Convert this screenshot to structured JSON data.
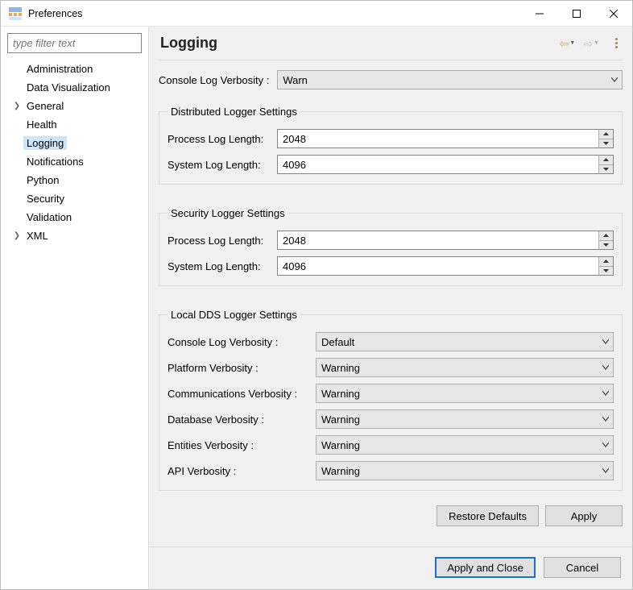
{
  "titlebar": {
    "title": "Preferences"
  },
  "filter": {
    "placeholder": "type filter text"
  },
  "tree": {
    "items": [
      {
        "label": "Administration",
        "expandable": false
      },
      {
        "label": "Data Visualization",
        "expandable": false
      },
      {
        "label": "General",
        "expandable": true
      },
      {
        "label": "Health",
        "expandable": false
      },
      {
        "label": "Logging",
        "expandable": false,
        "selected": true
      },
      {
        "label": "Notifications",
        "expandable": false
      },
      {
        "label": "Python",
        "expandable": false
      },
      {
        "label": "Security",
        "expandable": false
      },
      {
        "label": "Validation",
        "expandable": false
      },
      {
        "label": "XML",
        "expandable": true
      }
    ]
  },
  "page": {
    "title": "Logging",
    "consoleVerbosity": {
      "label": "Console Log Verbosity :",
      "value": "Warn"
    },
    "distributed": {
      "legend": "Distributed Logger Settings",
      "processLen": {
        "label": "Process Log Length:",
        "value": "2048"
      },
      "systemLen": {
        "label": "System Log Length:",
        "value": "4096"
      }
    },
    "security": {
      "legend": "Security Logger Settings",
      "processLen": {
        "label": "Process Log Length:",
        "value": "2048"
      },
      "systemLen": {
        "label": "System Log Length:",
        "value": "4096"
      }
    },
    "local": {
      "legend": "Local DDS Logger Settings",
      "rows": [
        {
          "label": "Console Log Verbosity :",
          "value": "Default"
        },
        {
          "label": "Platform Verbosity :",
          "value": "Warning"
        },
        {
          "label": "Communications Verbosity :",
          "value": "Warning"
        },
        {
          "label": "Database Verbosity :",
          "value": "Warning"
        },
        {
          "label": "Entities Verbosity :",
          "value": "Warning"
        },
        {
          "label": "API Verbosity :",
          "value": "Warning"
        }
      ]
    },
    "buttons": {
      "restore": "Restore Defaults",
      "apply": "Apply",
      "applyClose": "Apply and Close",
      "cancel": "Cancel"
    }
  }
}
